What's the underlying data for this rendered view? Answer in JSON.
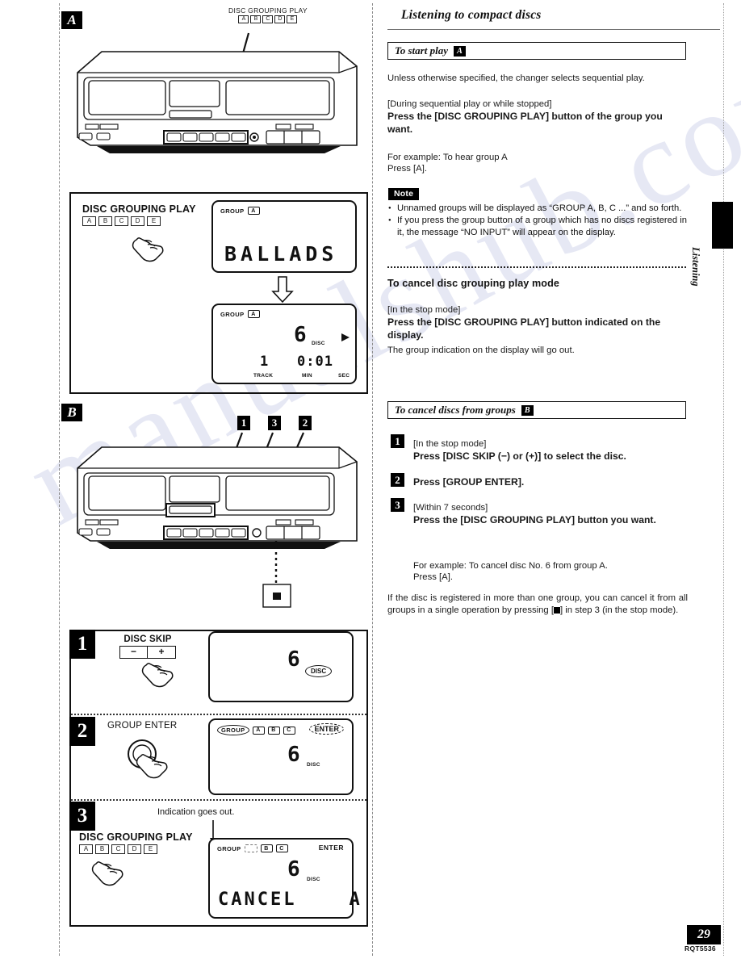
{
  "document": {
    "page_number": "29",
    "doc_code": "RQT5536",
    "side_tab_label": "Listening",
    "section_a_badge": "A",
    "section_b_badge": "B"
  },
  "right": {
    "title": "Listening to compact discs",
    "headbar_start": {
      "label": "To start play",
      "badge": "A"
    },
    "intro": "Unless otherwise specified, the changer selects sequential play.",
    "condition_1": "[During sequential play or while stopped]",
    "instruction_1": "Press the [DISC GROUPING PLAY] button of the group you want.",
    "example_1_line1": "For example: To hear group A",
    "example_1_line2": "Press [A].",
    "note_tag": "Note",
    "note_bullets": [
      "Unnamed groups will be displayed as “GROUP A, B, C ...” and so forth.",
      "If you press the group button of a group which has no discs registered in it, the message “NO INPUT” will appear on the display."
    ],
    "cancel_mode_heading": "To cancel disc grouping play mode",
    "condition_2": "[In the stop mode]",
    "instruction_2": "Press the [DISC GROUPING PLAY] button indicated on the display.",
    "result_2": "The group indication on the display will go out.",
    "headbar_cancel": {
      "label": "To cancel discs from groups",
      "badge": "B"
    },
    "steps": [
      {
        "num": "1",
        "condition": "[In the stop mode]",
        "instruction": "Press [DISC SKIP (−) or (+)] to select the disc.",
        "extra": ""
      },
      {
        "num": "2",
        "condition": "",
        "instruction": "Press [GROUP ENTER].",
        "extra": ""
      },
      {
        "num": "3",
        "condition": "[Within 7 seconds]",
        "instruction": "Press the [DISC GROUPING PLAY] button you want.",
        "extra_line1": "For example: To cancel disc No. 6 from group A.",
        "extra_line2": "Press [A]."
      }
    ],
    "footnote_a": "If the disc is registered in more than one group, you can cancel it from all groups in a single operation by pressing [",
    "footnote_b": "] in step 3 (in the stop mode)."
  },
  "left": {
    "a_callout": {
      "label": "DISC GROUPING PLAY",
      "keys": [
        "A",
        "B",
        "C",
        "D",
        "E"
      ]
    },
    "a_step_panel": {
      "button_label": "DISC GROUPING PLAY",
      "keys": [
        "A",
        "B",
        "C",
        "D",
        "E"
      ],
      "lcd_top": {
        "group_label": "GROUP",
        "group_value": "A",
        "text": "BALLADS"
      },
      "lcd_bottom": {
        "group_label": "GROUP",
        "group_value": "A",
        "disc_number": "6",
        "disc_unit": "DISC",
        "play_icon": "play-triangle",
        "track_number": "1",
        "track_label": "TRACK",
        "time": "0:01",
        "min_label": "MIN",
        "sec_label": "SEC"
      }
    },
    "b_callouts": [
      "1",
      "3",
      "2"
    ],
    "b_stop_button": "stop-square",
    "steps_panel": [
      {
        "num": "1",
        "control_label": "DISC SKIP",
        "control_keys": [
          "−",
          "+"
        ],
        "lcd": {
          "disc_number": "6",
          "disc_unit": "DISC"
        }
      },
      {
        "num": "2",
        "control_label": "GROUP ENTER",
        "lcd": {
          "group_label": "GROUP",
          "group_chips": [
            "A",
            "B",
            "C"
          ],
          "enter_label": "ENTER",
          "disc_number": "6",
          "disc_unit": "DISC"
        }
      },
      {
        "num": "3",
        "control_label": "DISC GROUPING PLAY",
        "control_keys": [
          "A",
          "B",
          "C",
          "D",
          "E"
        ],
        "annotation": "Indication goes out.",
        "lcd": {
          "group_label": "GROUP",
          "group_chips": [
            "B",
            "C"
          ],
          "enter_label": "ENTER",
          "disc_number": "6",
          "disc_unit": "DISC",
          "message": "CANCEL    A"
        }
      }
    ]
  },
  "watermark": {
    "text": "manualshub.com"
  }
}
